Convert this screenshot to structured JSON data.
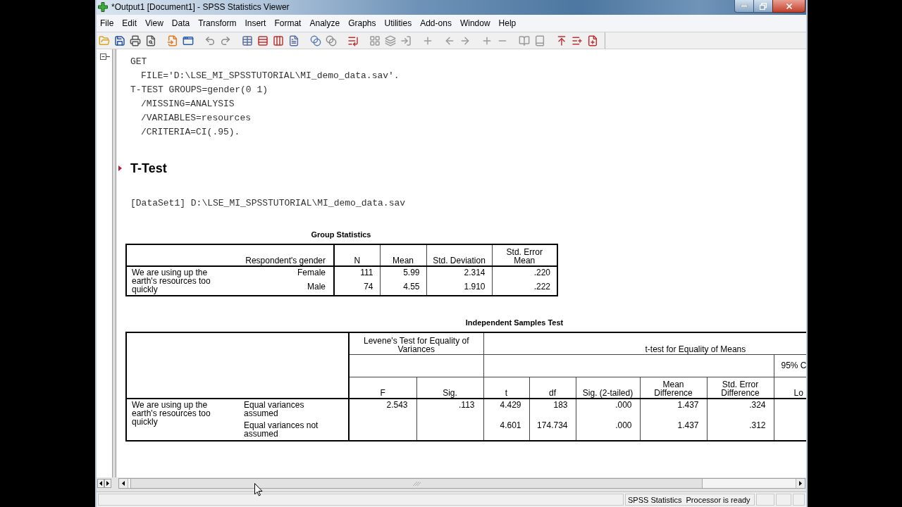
{
  "window": {
    "title": "*Output1 [Document1] - SPSS Statistics Viewer"
  },
  "menu": [
    "File",
    "Edit",
    "View",
    "Data",
    "Transform",
    "Insert",
    "Format",
    "Analyze",
    "Graphs",
    "Utilities",
    "Add-ons",
    "Window",
    "Help"
  ],
  "outline": {
    "expanded": true
  },
  "syntax": [
    {
      "text": "GET",
      "children": [
        {
          "text": "FILE='D:\\LSE_MI_SPSSTUTORIAL\\MI_demo_data.sav'."
        }
      ]
    },
    {
      "text": "T-TEST GROUPS=gender(0 1)",
      "children": [
        {
          "text": "/MISSING=ANALYSIS"
        },
        {
          "text": "/VARIABLES=resources"
        },
        {
          "text": "/CRITERIA=CI(.95)."
        }
      ]
    }
  ],
  "heading": {
    "text": "T-Test",
    "selected": true
  },
  "dataset_note": "[DataSet1] D:\\LSE_MI_SPSSTUTORIAL\\MI_demo_data.sav",
  "group_statistics": {
    "title": "Group Statistics",
    "row_header": "Respondent's gender",
    "columns": [
      "N",
      "Mean",
      "Std. Deviation",
      "Std. Error Mean"
    ],
    "variable": "We are using up the earth's resources too quickly",
    "rows": [
      {
        "group": "Female",
        "values": [
          "111",
          "5.99",
          "2.314",
          ".220"
        ]
      },
      {
        "group": "Male",
        "values": [
          "74",
          "4.55",
          "1.910",
          ".222"
        ]
      }
    ]
  },
  "independent_samples_test": {
    "title": "Independent Samples Test",
    "levene_header": "Levene's Test for Equality of Variances",
    "t_test_header": "t-test for Equality of Means",
    "interval_header": "95% C",
    "columns": [
      "F",
      "Sig.",
      "t",
      "df",
      "Sig. (2-tailed)",
      "Mean Difference",
      "Std. Error Difference",
      "Lo"
    ],
    "variable": "We are using up the earth's resources too quickly",
    "rows": [
      {
        "label": "Equal variances assumed",
        "levene": [
          "2.543",
          ".113"
        ],
        "t_test": [
          "4.429",
          "183",
          ".000",
          "1.437",
          ".324"
        ]
      },
      {
        "label": "Equal variances not assumed",
        "t_test": [
          "4.601",
          "174.734",
          ".000",
          "1.437",
          ".312"
        ]
      }
    ]
  },
  "status_bar": {
    "message": "SPSS Statistics  Processor is ready"
  }
}
